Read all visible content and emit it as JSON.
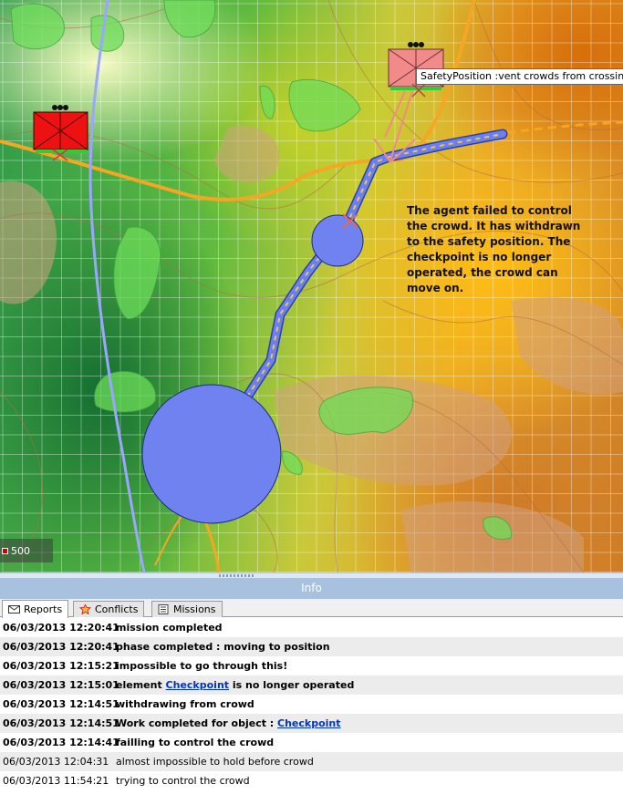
{
  "map": {
    "tooltip": "SafetyPosition :vent crowds from crossing",
    "note": "The agent failed to control the crowd. It has withdrawn to the safety position. The checkpoint is no longer operated, the crowd can move on.",
    "scale_label": "500",
    "colors": {
      "hostile_unit": "#ee1111",
      "safety_unit": "#f08a8a",
      "route": "#5b73e6",
      "road": "#f5a623",
      "river": "#9aa6ff"
    }
  },
  "info": {
    "title": "Info"
  },
  "tabs": [
    {
      "label": "Reports",
      "icon": "envelope-icon"
    },
    {
      "label": "Conflicts",
      "icon": "star-burst-icon"
    },
    {
      "label": "Missions",
      "icon": "list-icon"
    }
  ],
  "reports": [
    {
      "time": "06/03/2013 12:20:41",
      "text": "mission completed",
      "bold": true
    },
    {
      "time": "06/03/2013 12:20:41",
      "text": "phase completed : moving to position",
      "bold": true
    },
    {
      "time": "06/03/2013 12:15:21",
      "text": "impossible to go through this!",
      "bold": true
    },
    {
      "time": "06/03/2013 12:15:01",
      "text_before": "element ",
      "link": "Checkpoint",
      "text_after": " is no longer operated",
      "bold": true
    },
    {
      "time": "06/03/2013 12:14:51",
      "text": "withdrawing from crowd",
      "bold": true
    },
    {
      "time": "06/03/2013 12:14:51",
      "text_before": "Work completed for object : ",
      "link": "Checkpoint",
      "text_after": "",
      "bold": true
    },
    {
      "time": "06/03/2013 12:14:41",
      "text": "failling to control the crowd",
      "bold": true
    },
    {
      "time": "06/03/2013 12:04:31",
      "text": "almost impossible to hold before crowd",
      "bold": false
    },
    {
      "time": "06/03/2013 11:54:21",
      "text": "trying to control the crowd",
      "bold": false
    }
  ]
}
